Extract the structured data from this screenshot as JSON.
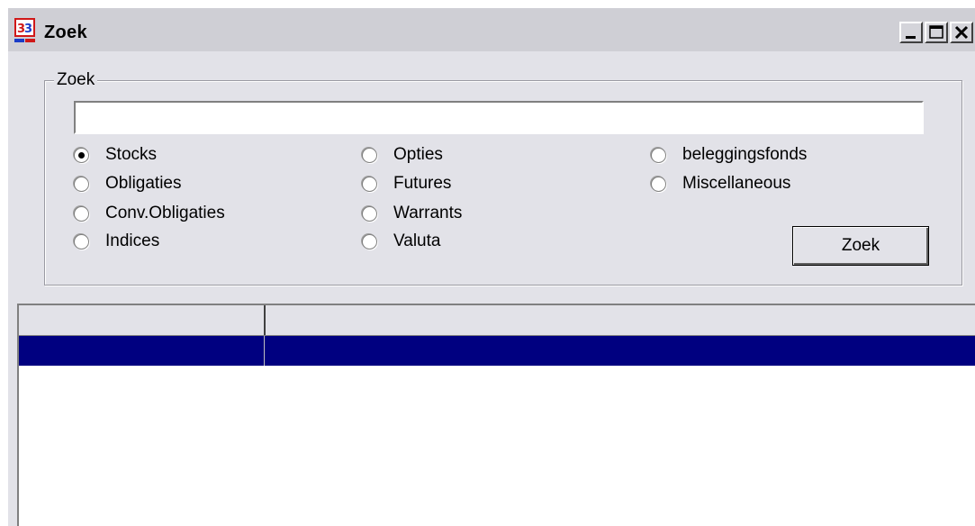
{
  "window": {
    "title": "Zoek",
    "icon": "app-logo-icon"
  },
  "group": {
    "legend": "Zoek",
    "search_value": "",
    "search_placeholder": ""
  },
  "radios": [
    {
      "label": "Stocks",
      "checked": true
    },
    {
      "label": "Obligaties",
      "checked": false
    },
    {
      "label": "Conv.Obligaties",
      "checked": false
    },
    {
      "label": "Indices",
      "checked": false
    },
    {
      "label": "Opties",
      "checked": false
    },
    {
      "label": "Futures",
      "checked": false
    },
    {
      "label": "Warrants",
      "checked": false
    },
    {
      "label": "Valuta",
      "checked": false
    },
    {
      "label": "beleggingsfonds",
      "checked": false
    },
    {
      "label": "Miscellaneous",
      "checked": false
    }
  ],
  "button": {
    "label": "Zoek"
  },
  "list": {
    "columns": [
      "",
      ""
    ],
    "selected_row": [
      "",
      ""
    ]
  },
  "colors": {
    "selection": "#000080",
    "face": "#e2e2e8"
  }
}
